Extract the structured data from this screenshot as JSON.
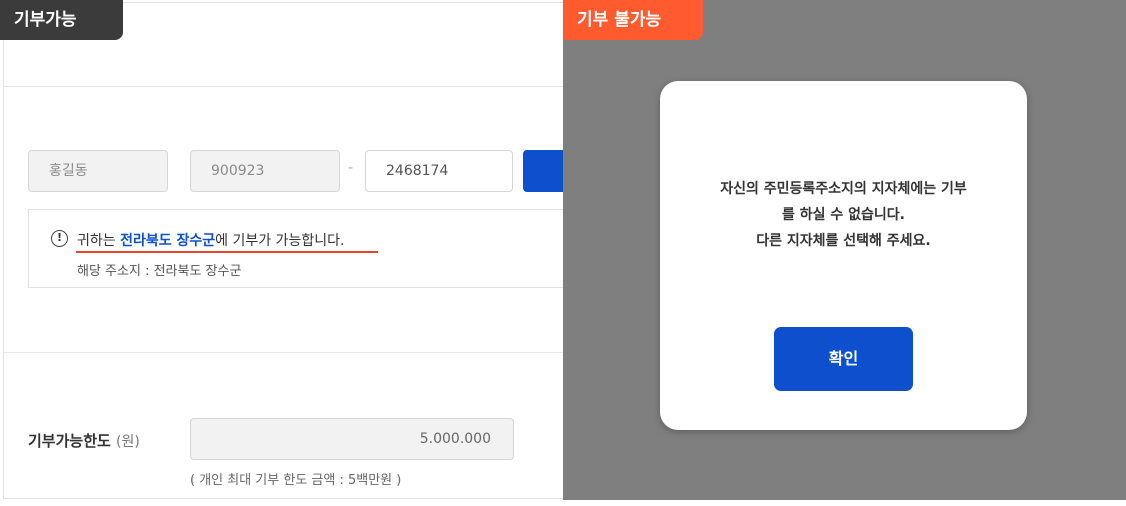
{
  "left_panel": {
    "badge": "기부가능",
    "form": {
      "name_value": "홍길동",
      "birth_value": "900923",
      "separator": "-",
      "id_back_value": "2468174"
    },
    "notice": {
      "icon": "alert-circle-icon",
      "icon_glyph": "!",
      "prefix": "귀하는 ",
      "region": "전라북도 장수군",
      "suffix": "에 기부가 가능합니다.",
      "address_line": "해당 주소지 : 전라북도 장수군"
    },
    "limit": {
      "label": "기부가능한도",
      "unit": "(원)",
      "value": "5.000.000",
      "note": "( 개인 최대 기부 한도 금액 : 5백만원 )"
    }
  },
  "right_panel": {
    "badge": "기부 불가능",
    "modal": {
      "message_lines": [
        "자신의 주민등록주소지의 지자체에는 기부",
        "를 하실 수 없습니다.",
        "다른 지자체를 선택해 주세요."
      ],
      "confirm_label": "확인"
    }
  },
  "colors": {
    "primary_blue": "#0d4fcc",
    "badge_dark": "#3b3b3b",
    "badge_orange": "#ff5b2e",
    "overlay_gray": "#7f7f7f",
    "underline_red": "#e5452a"
  }
}
